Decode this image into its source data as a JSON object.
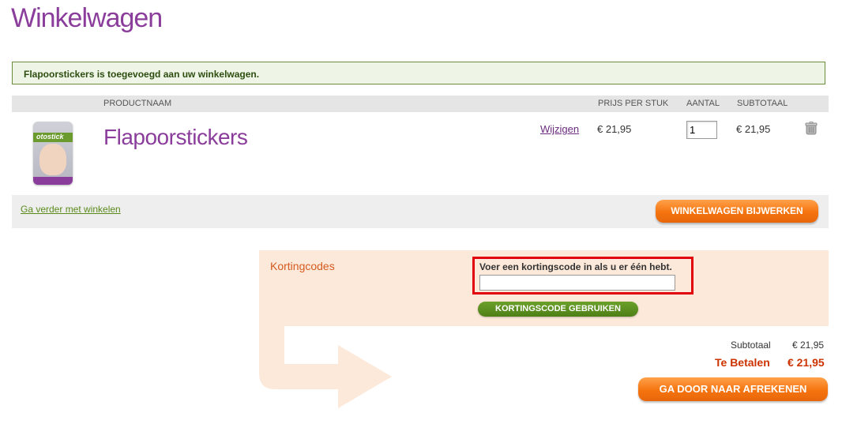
{
  "page": {
    "title": "Winkelwagen"
  },
  "messages": {
    "success": "Flapoorstickers is toegevoegd aan uw winkelwagen."
  },
  "cart": {
    "headers": {
      "product_name": "PRODUCTNAAM",
      "unit_price": "PRIJS PER STUK",
      "quantity": "AANTAL",
      "subtotal": "SUBTOTAAL"
    },
    "items": [
      {
        "name": "Flapoorstickers",
        "image_brand": "otostick",
        "edit_label": "Wijzigen",
        "unit_price": "€ 21,95",
        "quantity": "1",
        "subtotal": "€ 21,95",
        "remove_icon": "trash-icon"
      }
    ],
    "continue_label": "Ga verder met winkelen",
    "update_label": "WINKELWAGEN BIJWERKEN"
  },
  "discount": {
    "title": "Kortingcodes",
    "label": "Voer een kortingscode in als u er één hebt.",
    "input_value": "",
    "apply_label": "KORTINGSCODE GEBRUIKEN"
  },
  "totals": {
    "subtotal_label": "Subtotaal",
    "subtotal_value": "€ 21,95",
    "pay_label": "Te Betalen",
    "pay_value": "€ 21,95",
    "checkout_label": "GA DOOR NAAR AFREKENEN"
  },
  "colors": {
    "brand_purple": "#8b3d9c",
    "accent_orange": "#f5740f",
    "accent_green": "#4e7f17",
    "highlight_red": "#e0000e",
    "total_red": "#cc3300"
  }
}
